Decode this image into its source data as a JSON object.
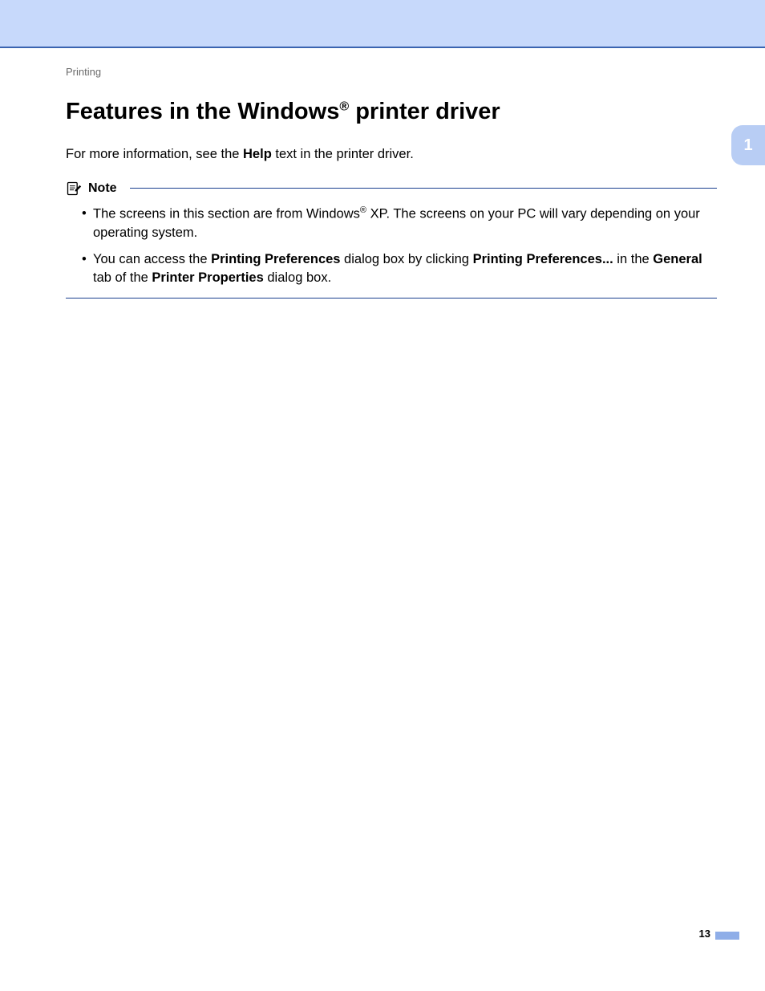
{
  "header": {
    "breadcrumb": "Printing"
  },
  "sideTab": {
    "label": "1"
  },
  "title": {
    "prefix": "Features in the Windows",
    "reg": "®",
    "suffix": " printer driver"
  },
  "intro": {
    "t1": "For more information, see the ",
    "b1": "Help",
    "t2": " text in the printer driver."
  },
  "note": {
    "label": "Note",
    "items": [
      {
        "t1": "The screens in this section are from Windows",
        "sup": "®",
        "t2": " XP. The screens on your PC will vary depending on your operating system."
      },
      {
        "t1": "You can access the ",
        "b1": "Printing Preferences",
        "t2": " dialog box by clicking ",
        "b2": "Printing Preferences...",
        "t3": " in the ",
        "b3": "General",
        "t4": " tab of the ",
        "b4": "Printer Properties",
        "t5": " dialog box."
      }
    ]
  },
  "footer": {
    "pageNumber": "13"
  }
}
